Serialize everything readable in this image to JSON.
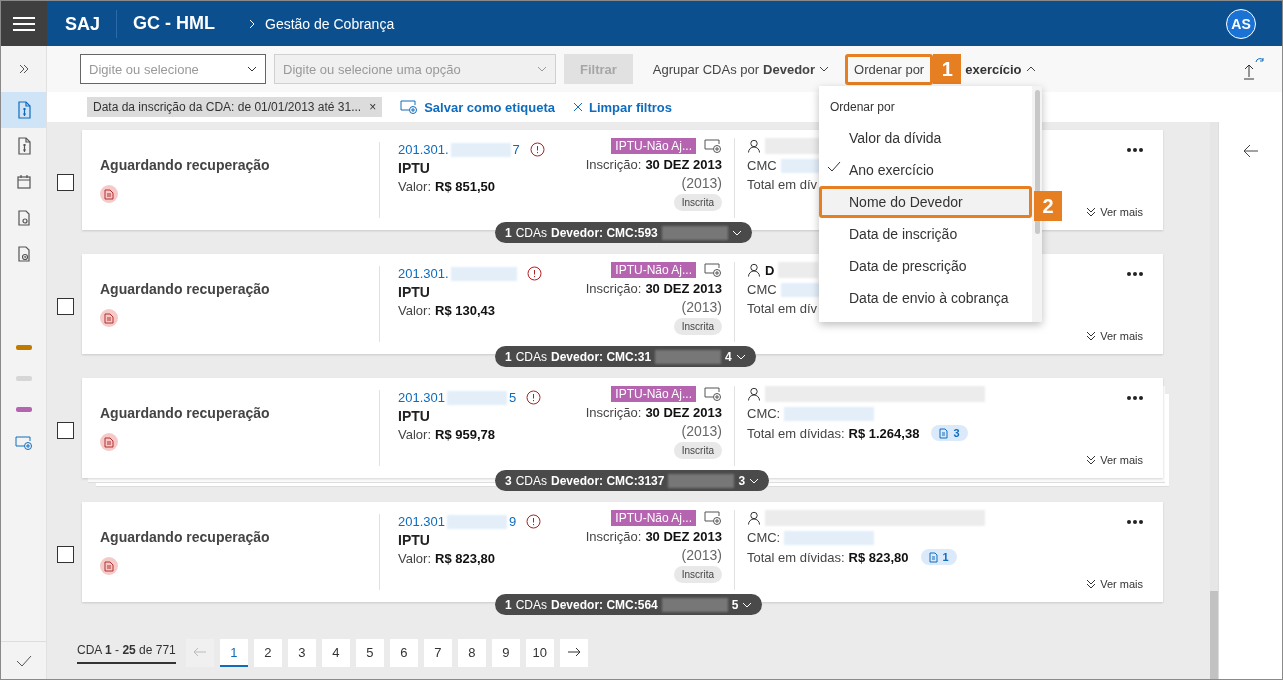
{
  "header": {
    "brand": "SAJ",
    "environment": "GC - HML",
    "breadcrumb": "Gestão de Cobrança",
    "avatar": "AS"
  },
  "rail": {
    "items": [
      {
        "kind": "money",
        "selected": true
      },
      {
        "kind": "money",
        "selected": false
      },
      {
        "kind": "calendar",
        "selected": false
      },
      {
        "kind": "gear",
        "selected": false
      },
      {
        "kind": "clock",
        "selected": false
      }
    ],
    "labels": [
      {
        "color": "#c17a00"
      },
      {
        "color": "#d6d6d6"
      },
      {
        "color": "#b565b0"
      }
    ]
  },
  "toolbar": {
    "field_1": {
      "placeholder": "Digite ou selecione",
      "disabled": false
    },
    "field_2": {
      "placeholder": "Digite ou selecione uma opção",
      "disabled": true
    },
    "filter_button": "Filtrar",
    "group_label": "Agrupar CDAs por",
    "group_value": "Devedor",
    "sort_label": "Ordenar por",
    "sort_value": "exercício",
    "expanded": true
  },
  "filters": {
    "chip": "Data da inscrição da CDA: de 01/01/2013 até 31...",
    "chip_close": "×",
    "save_label": "Salvar como etiqueta",
    "clear_label": "Limpar filtros"
  },
  "sort_menu": {
    "heading": "Ordenar por",
    "items": [
      {
        "label": "Valor da dívida",
        "checked": false,
        "highlighted": false
      },
      {
        "label": "Ano exercício",
        "checked": true,
        "highlighted": false
      },
      {
        "label": "Nome do Devedor",
        "checked": false,
        "highlighted": true
      },
      {
        "label": "Data de inscrição",
        "checked": false,
        "highlighted": false
      },
      {
        "label": "Data de prescrição",
        "checked": false,
        "highlighted": false
      },
      {
        "label": "Data de envio à cobrança",
        "checked": false,
        "highlighted": false
      }
    ]
  },
  "annotations": [
    {
      "number": "1"
    },
    {
      "number": "2"
    }
  ],
  "cards": [
    {
      "checked": false,
      "status": "Aguardando recuperação",
      "cda": "201.301.",
      "cda_end": "7",
      "tax": "IPTU",
      "value_label": "Valor:",
      "value": "R$ 851,50",
      "tag": "IPTU-Não Aj...",
      "inscription_label": "Inscrição:",
      "inscription_date": "30 DEZ 2013",
      "year": "(2013)",
      "situation": "Inscrita",
      "cmc_label": "CMC",
      "total_label": "Total em dív",
      "more": "Ver mais",
      "group_count": "1",
      "group_text": "CDAs",
      "group_label": "Devedor: CMC:593",
      "stacked": false
    },
    {
      "checked": false,
      "status": "Aguardando recuperação",
      "cda": "201.301.",
      "tax": "IPTU",
      "value_label": "Valor:",
      "value": "R$ 130,43",
      "tag": "IPTU-Não Aj...",
      "inscription_label": "Inscrição:",
      "inscription_date": "30 DEZ 2013",
      "year": "(2013)",
      "situation": "Inscrita",
      "debtor": "D",
      "cmc_label": "CMC",
      "total_label": "Total em dív",
      "more": "Ver mais",
      "group_count": "1",
      "group_text": "CDAs",
      "group_label": "Devedor: CMC:31",
      "group_end": "4",
      "stacked": false
    },
    {
      "checked": false,
      "status": "Aguardando recuperação",
      "cda": "201.301",
      "cda_end": "5",
      "tax": "IPTU",
      "value_label": "Valor:",
      "value": "R$ 959,78",
      "tag": "IPTU-Não Aj...",
      "inscription_label": "Inscrição:",
      "inscription_date": "30 DEZ 2013",
      "year": "(2013)",
      "situation": "Inscrita",
      "cmc_label": "CMC:",
      "total_label": "Total em dívidas:",
      "total": "R$ 1.264,38",
      "docs": "3",
      "more": "Ver mais",
      "group_count": "3",
      "group_text": "CDAs",
      "group_label": "Devedor: CMC:3137",
      "group_end": "3",
      "stacked": true
    },
    {
      "checked": false,
      "status": "Aguardando recuperação",
      "cda": "201.301",
      "cda_end": "9",
      "tax": "IPTU",
      "value_label": "Valor:",
      "value": "R$ 823,80",
      "tag": "IPTU-Não Aj...",
      "inscription_label": "Inscrição:",
      "inscription_date": "30 DEZ 2013",
      "year": "(2013)",
      "situation": "Inscrita",
      "cmc_label": "CMC:",
      "total_label": "Total em dívidas:",
      "total": "R$ 823,80",
      "docs": "1",
      "more": "Ver mais",
      "group_count": "1",
      "group_text": "CDAs",
      "group_label": "Devedor: CMC:564",
      "group_end": "5",
      "stacked": false
    }
  ],
  "pagination": {
    "summary": "CDA **1** - **25** de 771",
    "prev_disabled": true,
    "pages": [
      {
        "label": "1",
        "selected": true
      },
      {
        "label": "2",
        "selected": false
      },
      {
        "label": "3",
        "selected": false
      },
      {
        "label": "4",
        "selected": false
      },
      {
        "label": "5",
        "selected": false
      },
      {
        "label": "6",
        "selected": false
      },
      {
        "label": "7",
        "selected": false
      },
      {
        "label": "8",
        "selected": false
      },
      {
        "label": "9",
        "selected": false
      },
      {
        "label": "10",
        "selected": false
      }
    ]
  }
}
